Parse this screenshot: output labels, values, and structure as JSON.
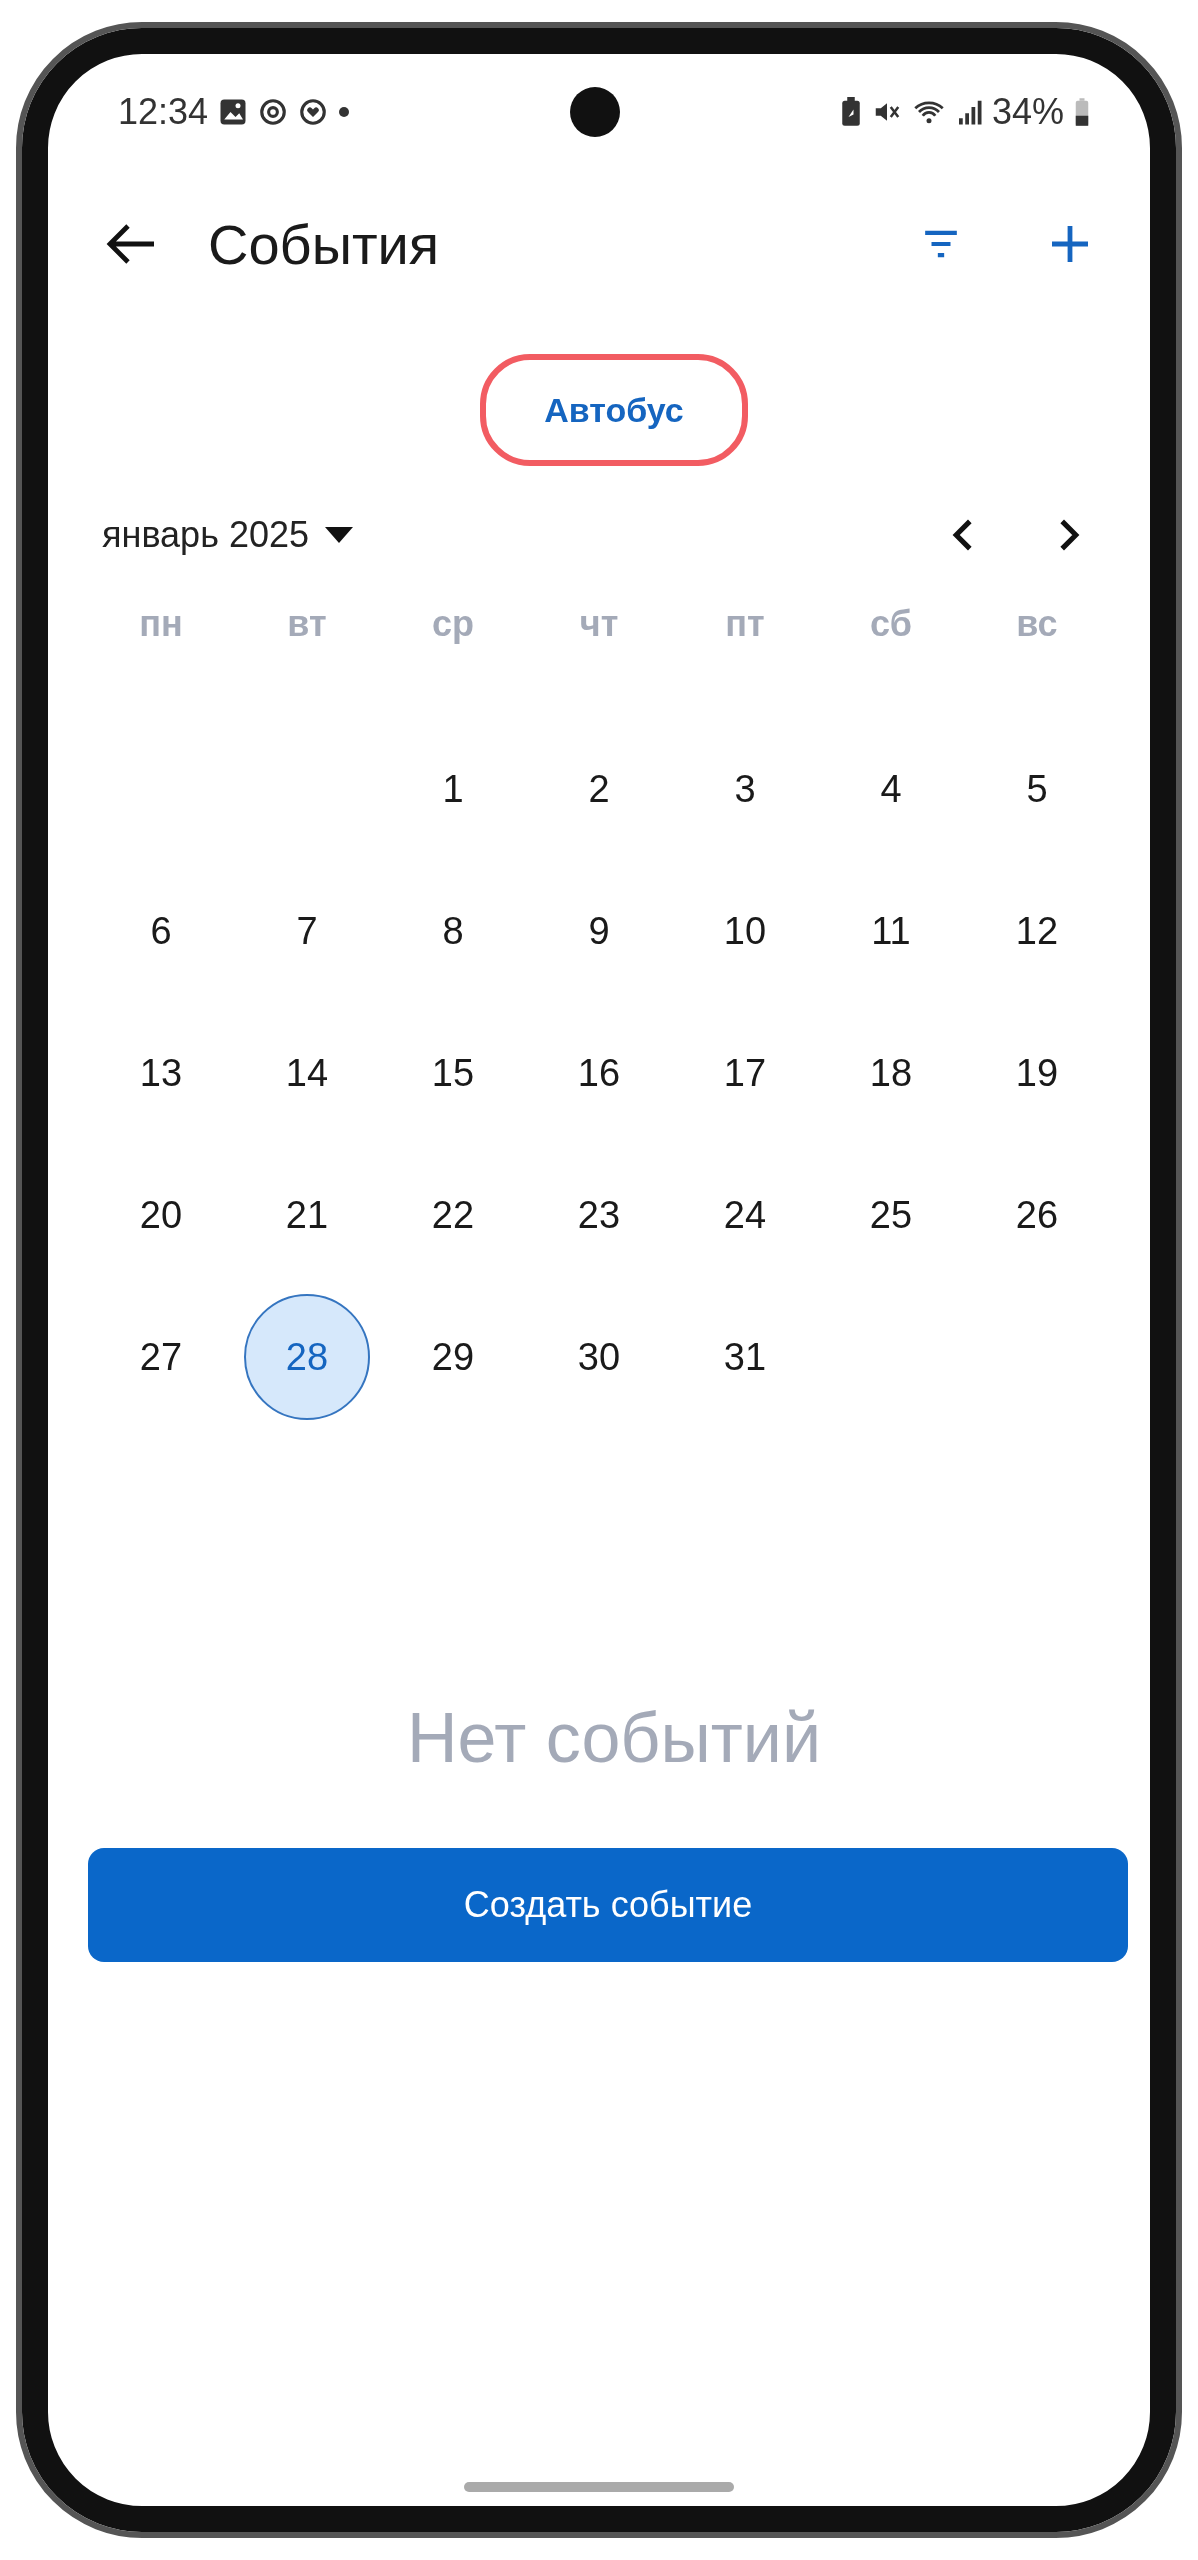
{
  "status_bar": {
    "time": "12:34",
    "battery": "34%"
  },
  "header": {
    "title": "События"
  },
  "chip": {
    "label": "Автобус",
    "highlighted": true
  },
  "calendar": {
    "month": "январь 2025",
    "weekdays": [
      "пн",
      "вт",
      "ср",
      "чт",
      "пт",
      "сб",
      "вс"
    ],
    "weeks": [
      [
        {
          "day": "1",
          "selected": false
        },
        {
          "day": "2",
          "selected": false
        },
        {
          "day": "3",
          "selected": false
        },
        {
          "day": "4",
          "selected": false
        },
        {
          "day": "5",
          "selected": false
        }
      ],
      [
        {
          "day": "6",
          "selected": false
        },
        {
          "day": "7",
          "selected": false
        },
        {
          "day": "8",
          "selected": false
        },
        {
          "day": "9",
          "selected": false
        },
        {
          "day": "10",
          "selected": false
        },
        {
          "day": "11",
          "selected": false
        },
        {
          "day": "12",
          "selected": false
        }
      ],
      [
        {
          "day": "13",
          "selected": false
        },
        {
          "day": "14",
          "selected": false
        },
        {
          "day": "15",
          "selected": false
        },
        {
          "day": "16",
          "selected": false
        },
        {
          "day": "17",
          "selected": false
        },
        {
          "day": "18",
          "selected": false
        },
        {
          "day": "19",
          "selected": false
        }
      ],
      [
        {
          "day": "20",
          "selected": false
        },
        {
          "day": "21",
          "selected": false
        },
        {
          "day": "22",
          "selected": false
        },
        {
          "day": "23",
          "selected": false
        },
        {
          "day": "24",
          "selected": false
        },
        {
          "day": "25",
          "selected": false
        },
        {
          "day": "26",
          "selected": false
        }
      ],
      [
        {
          "day": "27",
          "selected": false
        },
        {
          "day": "28",
          "selected": true
        },
        {
          "day": "29",
          "selected": false
        },
        {
          "day": "30",
          "selected": false
        },
        {
          "day": "31",
          "selected": false
        }
      ]
    ]
  },
  "empty_message": "Нет событий",
  "create_button": "Создать событие"
}
